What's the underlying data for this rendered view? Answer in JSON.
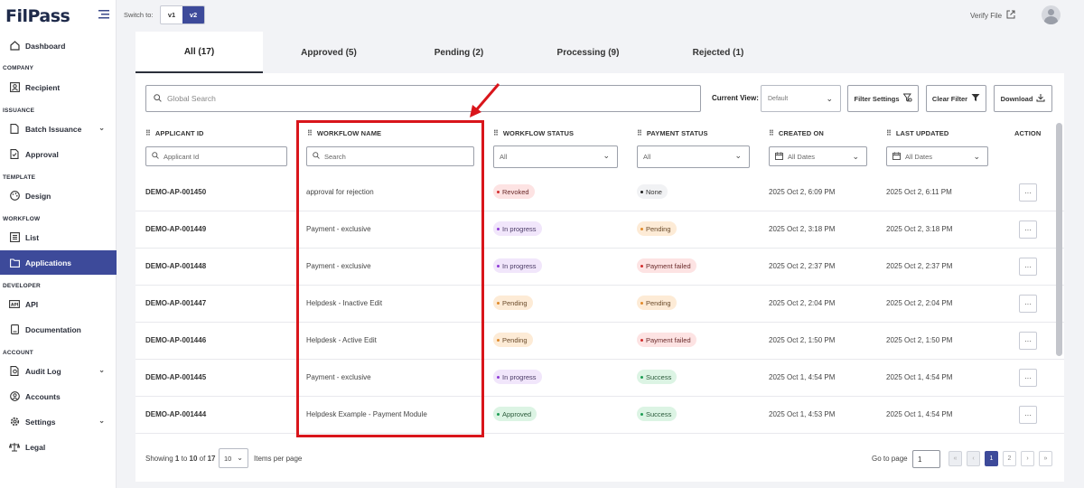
{
  "app": {
    "logo": "FilPass"
  },
  "sidebar": {
    "dashboard": "Dashboard",
    "company_section": "COMPANY",
    "recipient": "Recipient",
    "issuance_section": "ISSUANCE",
    "batch_issuance": "Batch Issuance",
    "approval": "Approval",
    "template_section": "TEMPLATE",
    "design": "Design",
    "workflow_section": "WORKFLOW",
    "list": "List",
    "applications": "Applications",
    "developer_section": "DEVELOPER",
    "api": "API",
    "documentation": "Documentation",
    "account_section": "ACCOUNT",
    "audit_log": "Audit Log",
    "accounts": "Accounts",
    "settings": "Settings",
    "legal": "Legal"
  },
  "topbar": {
    "switch_label": "Switch to:",
    "v1": "v1",
    "v2": "v2",
    "verify": "Verify File"
  },
  "tabs": {
    "all": "All (17)",
    "approved": "Approved (5)",
    "pending": "Pending (2)",
    "processing": "Processing (9)",
    "rejected": "Rejected (1)"
  },
  "toolbar": {
    "search_placeholder": "Global Search",
    "current_view_label": "Current View:",
    "current_view_value": "Default",
    "filter_settings": "Filter Settings",
    "clear_filter": "Clear Filter",
    "download": "Download"
  },
  "columns": {
    "applicant_id": "APPLICANT ID",
    "workflow_name": "WORKFLOW NAME",
    "workflow_status": "WORKFLOW STATUS",
    "payment_status": "PAYMENT STATUS",
    "created_on": "CREATED ON",
    "last_updated": "LAST UPDATED",
    "action": "ACTION"
  },
  "filters": {
    "applicant_id": "Applicant Id",
    "workflow_name": "Search",
    "workflow_status": "All",
    "payment_status": "All",
    "created_on": "All Dates",
    "last_updated": "All Dates"
  },
  "rows": [
    {
      "id": "DEMO-AP-001450",
      "workflow": "approval for rejection",
      "wf_status": "Revoked",
      "pay_status": "None",
      "created": "2025 Oct 2, 6:09 PM",
      "updated": "2025 Oct 2, 6:11 PM",
      "action": "···"
    },
    {
      "id": "DEMO-AP-001449",
      "workflow": "Payment - exclusive",
      "wf_status": "In progress",
      "pay_status": "Pending",
      "created": "2025 Oct 2, 3:18 PM",
      "updated": "2025 Oct 2, 3:18 PM",
      "action": "···"
    },
    {
      "id": "DEMO-AP-001448",
      "workflow": "Payment - exclusive",
      "wf_status": "In progress",
      "pay_status": "Payment failed",
      "created": "2025 Oct 2, 2:37 PM",
      "updated": "2025 Oct 2, 2:37 PM",
      "action": "···"
    },
    {
      "id": "DEMO-AP-001447",
      "workflow": "Helpdesk - Inactive Edit",
      "wf_status": "Pending",
      "pay_status": "Pending",
      "created": "2025 Oct 2, 2:04 PM",
      "updated": "2025 Oct 2, 2:04 PM",
      "action": "···"
    },
    {
      "id": "DEMO-AP-001446",
      "workflow": "Helpdesk - Active Edit",
      "wf_status": "Pending",
      "pay_status": "Payment failed",
      "created": "2025 Oct 2, 1:50 PM",
      "updated": "2025 Oct 2, 1:50 PM",
      "action": "···"
    },
    {
      "id": "DEMO-AP-001445",
      "workflow": "Payment - exclusive",
      "wf_status": "In progress",
      "pay_status": "Success",
      "created": "2025 Oct 1, 4:54 PM",
      "updated": "2025 Oct 1, 4:54 PM",
      "action": "···"
    },
    {
      "id": "DEMO-AP-001444",
      "workflow": "Helpdesk Example - Payment Module",
      "wf_status": "Approved",
      "pay_status": "Success",
      "created": "2025 Oct 1, 4:53 PM",
      "updated": "2025 Oct 1, 4:54 PM",
      "action": "···"
    }
  ],
  "footer": {
    "showing_prefix": "Showing",
    "from": "1",
    "to_word": "to",
    "to": "10",
    "of_word": "of",
    "total": "17",
    "per_page": "10",
    "items_per_page": "Items per page",
    "go_to_page": "Go to page",
    "page_input": "1",
    "first": "«",
    "prev": "‹",
    "page1": "1",
    "page2": "2",
    "next": "›",
    "last": "»"
  },
  "colors": {
    "accent": "#3d4a9a",
    "highlight": "#d9151b"
  }
}
